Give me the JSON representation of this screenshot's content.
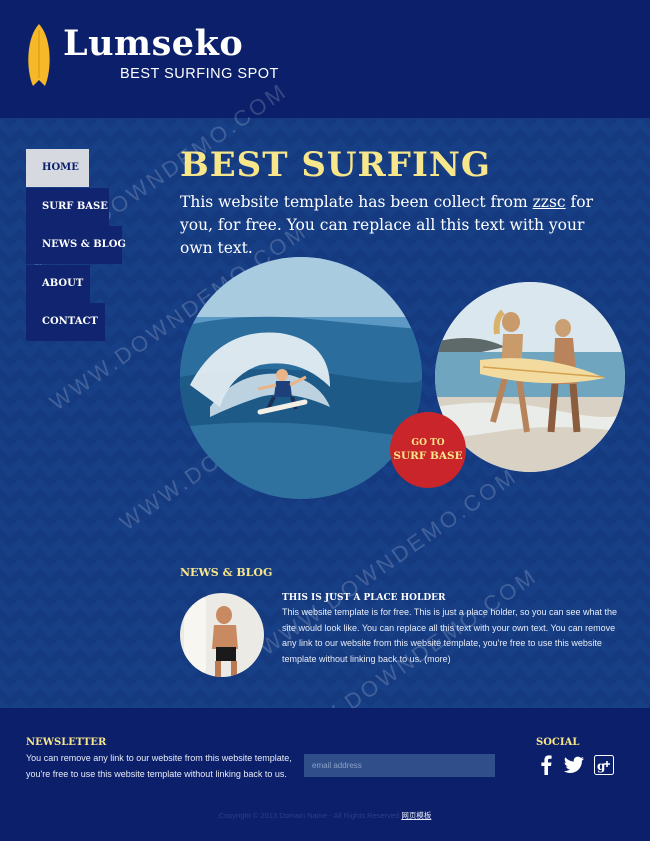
{
  "header": {
    "logo_title": "Lumseko",
    "logo_subtitle": "BEST SURFING  SPOT",
    "logo_icon": "surfboard-icon"
  },
  "nav": {
    "items": [
      {
        "label": "HOME",
        "active": true
      },
      {
        "label": "SURF BASE",
        "active": false
      },
      {
        "label": "NEWS & BLOG",
        "active": false
      },
      {
        "label": "ABOUT",
        "active": false
      },
      {
        "label": "CONTACT",
        "active": false
      }
    ]
  },
  "hero": {
    "title": "BEST SURFING",
    "text_before": "This website template has been collect from ",
    "link": "zzsc",
    "text_after": " for you, for free. You can replace all this text with your own text."
  },
  "goto": {
    "line1": "GO TO",
    "line2": "SURF BASE"
  },
  "news": {
    "heading": "NEWS & BLOG",
    "post_title": "THIS IS JUST A PLACE HOLDER",
    "post_body": "This website template is for free.  This is just a place holder, so you can see what the site would look like. You can replace all this text with your own text. You can remove any link to our website from this website template, you're free to use this website template without linking back to us. ",
    "more": "(more)"
  },
  "newsletter": {
    "heading": "NEWSLETTER",
    "text": "You can remove any link to our website from this website template, you're free to use this website template without linking back to us.",
    "placeholder": "email address"
  },
  "social": {
    "heading": "SOCIAL",
    "icons": [
      "facebook-icon",
      "twitter-icon",
      "google-plus-icon"
    ]
  },
  "footer": {
    "copyright": "Copyright © 2013 Domain Name - All Rights Reserved  ",
    "link": "网页模板"
  },
  "watermark": {
    "text": "WWW.DOWNDEMO.COM"
  },
  "colors": {
    "header_bg": "#0b1f6b",
    "body_bg": "#173f86",
    "accent_yellow": "#f8e68a",
    "goto_red": "#c9252a"
  }
}
